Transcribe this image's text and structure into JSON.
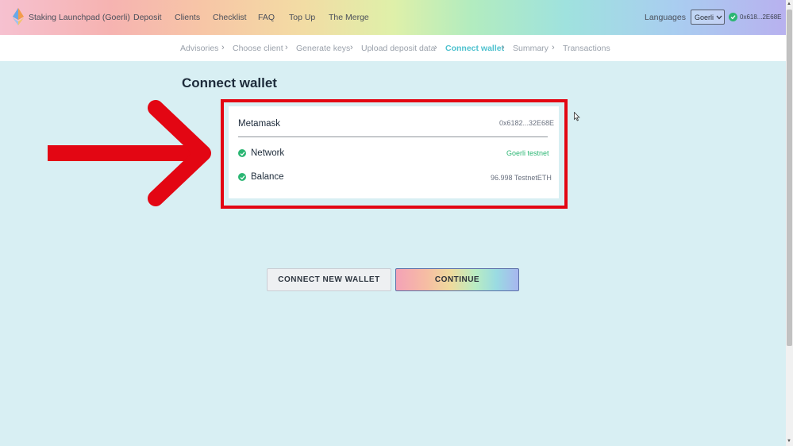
{
  "nav": {
    "brand": "Staking Launchpad (Goerli)",
    "links": [
      "Deposit",
      "Clients",
      "Checklist",
      "FAQ",
      "Top Up",
      "The Merge"
    ],
    "languages": "Languages",
    "network_select": "Goerli",
    "account": "0x618...2E68E"
  },
  "breadcrumb": {
    "items": [
      "Advisories",
      "Choose client",
      "Generate keys",
      "Upload deposit data",
      "Connect wallet",
      "Summary",
      "Transactions"
    ],
    "active": "Connect wallet"
  },
  "page": {
    "title": "Connect wallet"
  },
  "wallet_card": {
    "provider": "Metamask",
    "address": "0x6182...32E68E",
    "rows": [
      {
        "label": "Network",
        "value": "Goerli testnet",
        "value_color": "#2bb673"
      },
      {
        "label": "Balance",
        "value": "96.998 TestnetETH",
        "value_color": "#6b7280"
      }
    ]
  },
  "buttons": {
    "connect_new": "CONNECT NEW WALLET",
    "continue": "CONTINUE"
  },
  "colors": {
    "highlight": "#e30613",
    "success": "#2bb673",
    "active_crumb": "#4fc2cf"
  }
}
